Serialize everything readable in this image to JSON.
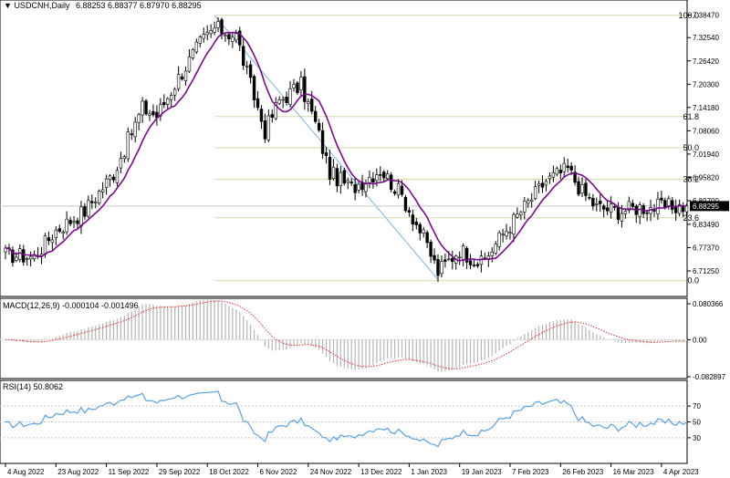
{
  "colors": {
    "background": "#ffffff",
    "candle": "#000000",
    "ma": "#7a0a8c",
    "fib": "#d7d9a8",
    "trendline": "#7db3e6",
    "price_line": "#c8c8c8",
    "price_label_bg": "#000000",
    "macd_hist": "#b4b4b4",
    "macd_signal": "#e63232",
    "rsi": "#5aa0e6",
    "rsi_levels": "#c8c8c8"
  },
  "chart_data": [
    {
      "type": "candlestick",
      "header": {
        "symbol": "USDCNH,Daily",
        "ohlc": "6.88253 6.88377 6.87970 6.88295"
      },
      "ylim": [
        6.655,
        7.405
      ],
      "y_ticks": [
        "7.38470",
        "7.32540",
        "7.26420",
        "7.20300",
        "7.14180",
        "7.08060",
        "7.01940",
        "6.95820",
        "6.89700",
        "6.83490",
        "6.77370",
        "6.71250"
      ],
      "current_price_label": "6.88295",
      "x_labels": [
        {
          "i": 0,
          "label": "4 Aug 2022"
        },
        {
          "i": 14,
          "label": "23 Aug 2022"
        },
        {
          "i": 28,
          "label": "11 Sep 2022"
        },
        {
          "i": 42,
          "label": "29 Sep 2022"
        },
        {
          "i": 56,
          "label": "18 Oct 2022"
        },
        {
          "i": 70,
          "label": "6 Nov 2022"
        },
        {
          "i": 84,
          "label": "24 Nov 2022"
        },
        {
          "i": 98,
          "label": "13 Dec 2022"
        },
        {
          "i": 112,
          "label": "1 Jan 2023"
        },
        {
          "i": 126,
          "label": "19 Jan 2023"
        },
        {
          "i": 140,
          "label": "7 Feb 2023"
        },
        {
          "i": 154,
          "label": "26 Feb 2023"
        },
        {
          "i": 168,
          "label": "16 Mar 2023"
        },
        {
          "i": 182,
          "label": "4 Apr 2023"
        }
      ],
      "anchors": [
        [
          0,
          6.755
        ],
        [
          8,
          6.75
        ],
        [
          14,
          6.82
        ],
        [
          22,
          6.87
        ],
        [
          30,
          6.97
        ],
        [
          38,
          7.14
        ],
        [
          42,
          7.12
        ],
        [
          48,
          7.22
        ],
        [
          54,
          7.31
        ],
        [
          58,
          7.35
        ],
        [
          64,
          7.33
        ],
        [
          68,
          7.2
        ],
        [
          72,
          7.08
        ],
        [
          76,
          7.16
        ],
        [
          82,
          7.2
        ],
        [
          86,
          7.1
        ],
        [
          90,
          6.97
        ],
        [
          96,
          6.93
        ],
        [
          104,
          6.98
        ],
        [
          110,
          6.91
        ],
        [
          116,
          6.8
        ],
        [
          120,
          6.71
        ],
        [
          126,
          6.77
        ],
        [
          132,
          6.73
        ],
        [
          138,
          6.81
        ],
        [
          144,
          6.88
        ],
        [
          150,
          6.95
        ],
        [
          156,
          6.98
        ],
        [
          160,
          6.92
        ],
        [
          164,
          6.88
        ],
        [
          170,
          6.87
        ],
        [
          176,
          6.88
        ],
        [
          182,
          6.88
        ],
        [
          189,
          6.883
        ]
      ],
      "fib_levels": [
        {
          "level": "100.0",
          "price": 7.384
        },
        {
          "level": "61.8",
          "price": 7.118
        },
        {
          "level": "50.0",
          "price": 7.036
        },
        {
          "level": "38.2",
          "price": 6.953
        },
        {
          "level": "23.6",
          "price": 6.852
        },
        {
          "level": "0.0",
          "price": 6.687
        }
      ],
      "fib_start_index": 58,
      "trendline": [
        [
          58,
          7.384
        ],
        [
          120,
          6.69
        ]
      ],
      "ma_period": 9
    },
    {
      "type": "bar+line",
      "header": "MACD(12,26,9) -0.000104 -0.001496",
      "y_ticks": [
        "0.080366",
        "0.00",
        "-0.082897"
      ],
      "ylim": [
        -0.0829,
        0.0804
      ]
    },
    {
      "type": "line",
      "header": "RSI(14) 50.8062",
      "y_ticks": [
        "70",
        "50",
        "30"
      ],
      "ylim": [
        0,
        100
      ],
      "levels": [
        70,
        50,
        30
      ],
      "scale_max_label": "100",
      "scale_min_label": "0"
    }
  ]
}
